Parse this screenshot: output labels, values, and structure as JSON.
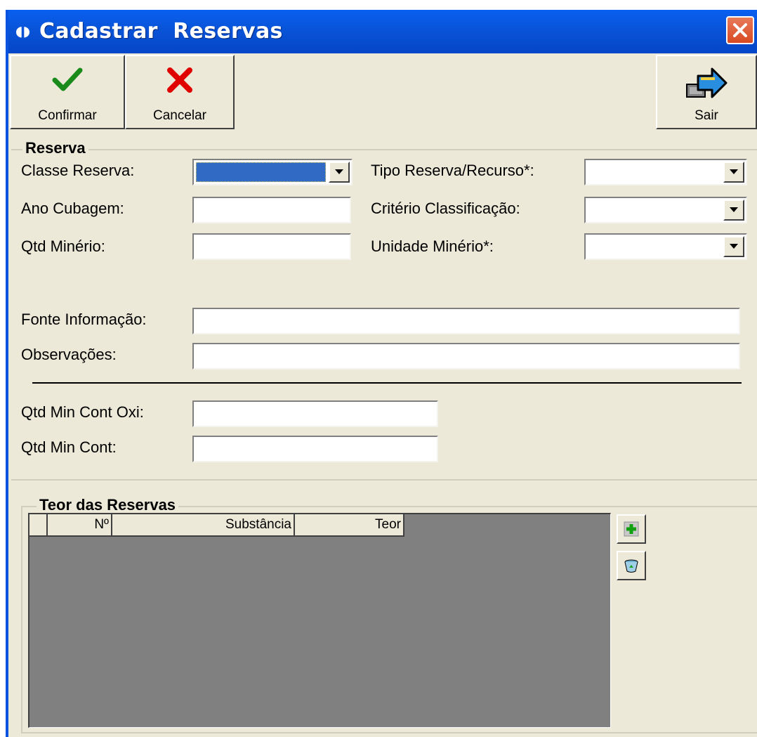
{
  "window": {
    "title": "Cadastrar  Reservas",
    "accent": "#0a53e0"
  },
  "toolbar": {
    "confirm_label": "Confirmar",
    "cancel_label": "Cancelar",
    "exit_label": "Sair"
  },
  "reserva": {
    "group_title": "Reserva",
    "classe_reserva_label": "Classe Reserva:",
    "classe_reserva_value": "",
    "ano_cubagem_label": "Ano Cubagem:",
    "ano_cubagem_value": "",
    "qtd_minerio_label": "Qtd Minério:",
    "qtd_minerio_value": "",
    "tipo_reserva_label": "Tipo Reserva/Recurso*:",
    "tipo_reserva_value": "",
    "criterio_label": "Critério Classificação:",
    "criterio_value": "",
    "unidade_label": "Unidade Minério*:",
    "unidade_value": "",
    "fonte_label": "Fonte Informação:",
    "fonte_value": "",
    "observacoes_label": "Observações:",
    "observacoes_value": "",
    "qtd_min_cont_oxi_label": "Qtd Min Cont Oxi:",
    "qtd_min_cont_oxi_value": "",
    "qtd_min_cont_label": "Qtd Min Cont:",
    "qtd_min_cont_value": ""
  },
  "teor": {
    "group_title": "Teor das Reservas",
    "columns": [
      "",
      "Nº",
      "Substância",
      "Teor"
    ],
    "rows": []
  },
  "icons": {
    "confirm": "checkmark-icon",
    "cancel": "x-icon",
    "exit": "exit-arrow-icon",
    "add": "add-plus-icon",
    "delete": "delete-bin-icon"
  }
}
